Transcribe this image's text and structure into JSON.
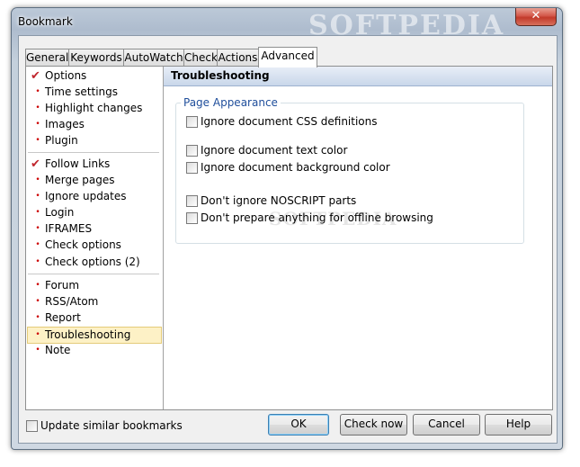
{
  "window": {
    "title": "Bookmark",
    "watermark": "SOFTPEDIA",
    "close_glyph": "✕"
  },
  "tabs": [
    {
      "label": "General"
    },
    {
      "label": "Keywords"
    },
    {
      "label": "AutoWatch"
    },
    {
      "label": "Check"
    },
    {
      "label": "Actions"
    },
    {
      "label": "Advanced",
      "active": true
    }
  ],
  "nav": {
    "group1": [
      {
        "label": "Options",
        "marker": "check"
      },
      {
        "label": "Time settings",
        "marker": "bullet"
      },
      {
        "label": "Highlight changes",
        "marker": "bullet"
      },
      {
        "label": "Images",
        "marker": "bullet"
      },
      {
        "label": "Plugin",
        "marker": "bullet"
      }
    ],
    "group2": [
      {
        "label": "Follow Links",
        "marker": "check"
      },
      {
        "label": "Merge pages",
        "marker": "bullet"
      },
      {
        "label": "Ignore updates",
        "marker": "bullet"
      },
      {
        "label": "Login",
        "marker": "bullet"
      },
      {
        "label": "IFRAMES",
        "marker": "bullet"
      },
      {
        "label": "Check options",
        "marker": "bullet"
      },
      {
        "label": "Check options (2)",
        "marker": "bullet"
      }
    ],
    "group3": [
      {
        "label": "Forum",
        "marker": "bullet"
      },
      {
        "label": "RSS/Atom",
        "marker": "bullet"
      },
      {
        "label": "Report",
        "marker": "bullet"
      },
      {
        "label": "Troubleshooting",
        "marker": "bullet",
        "selected": true
      },
      {
        "label": "Note",
        "marker": "bullet"
      }
    ]
  },
  "content": {
    "header": "Troubleshooting",
    "group_title": "Page Appearance",
    "options": [
      {
        "label": "Ignore document CSS definitions",
        "checked": false
      },
      {
        "label": "Ignore document text color",
        "checked": false
      },
      {
        "label": "Ignore document background color",
        "checked": false
      },
      {
        "label": "Don't ignore NOSCRIPT parts",
        "checked": false
      },
      {
        "label": "Don't prepare anything for offline browsing",
        "checked": false
      }
    ],
    "watermark": "SOFTPEDIA"
  },
  "footer": {
    "update_similar_label": "Update similar bookmarks",
    "update_similar_checked": false,
    "ok_label": "OK",
    "check_now_label": "Check now",
    "cancel_label": "Cancel",
    "help_label": "Help"
  }
}
